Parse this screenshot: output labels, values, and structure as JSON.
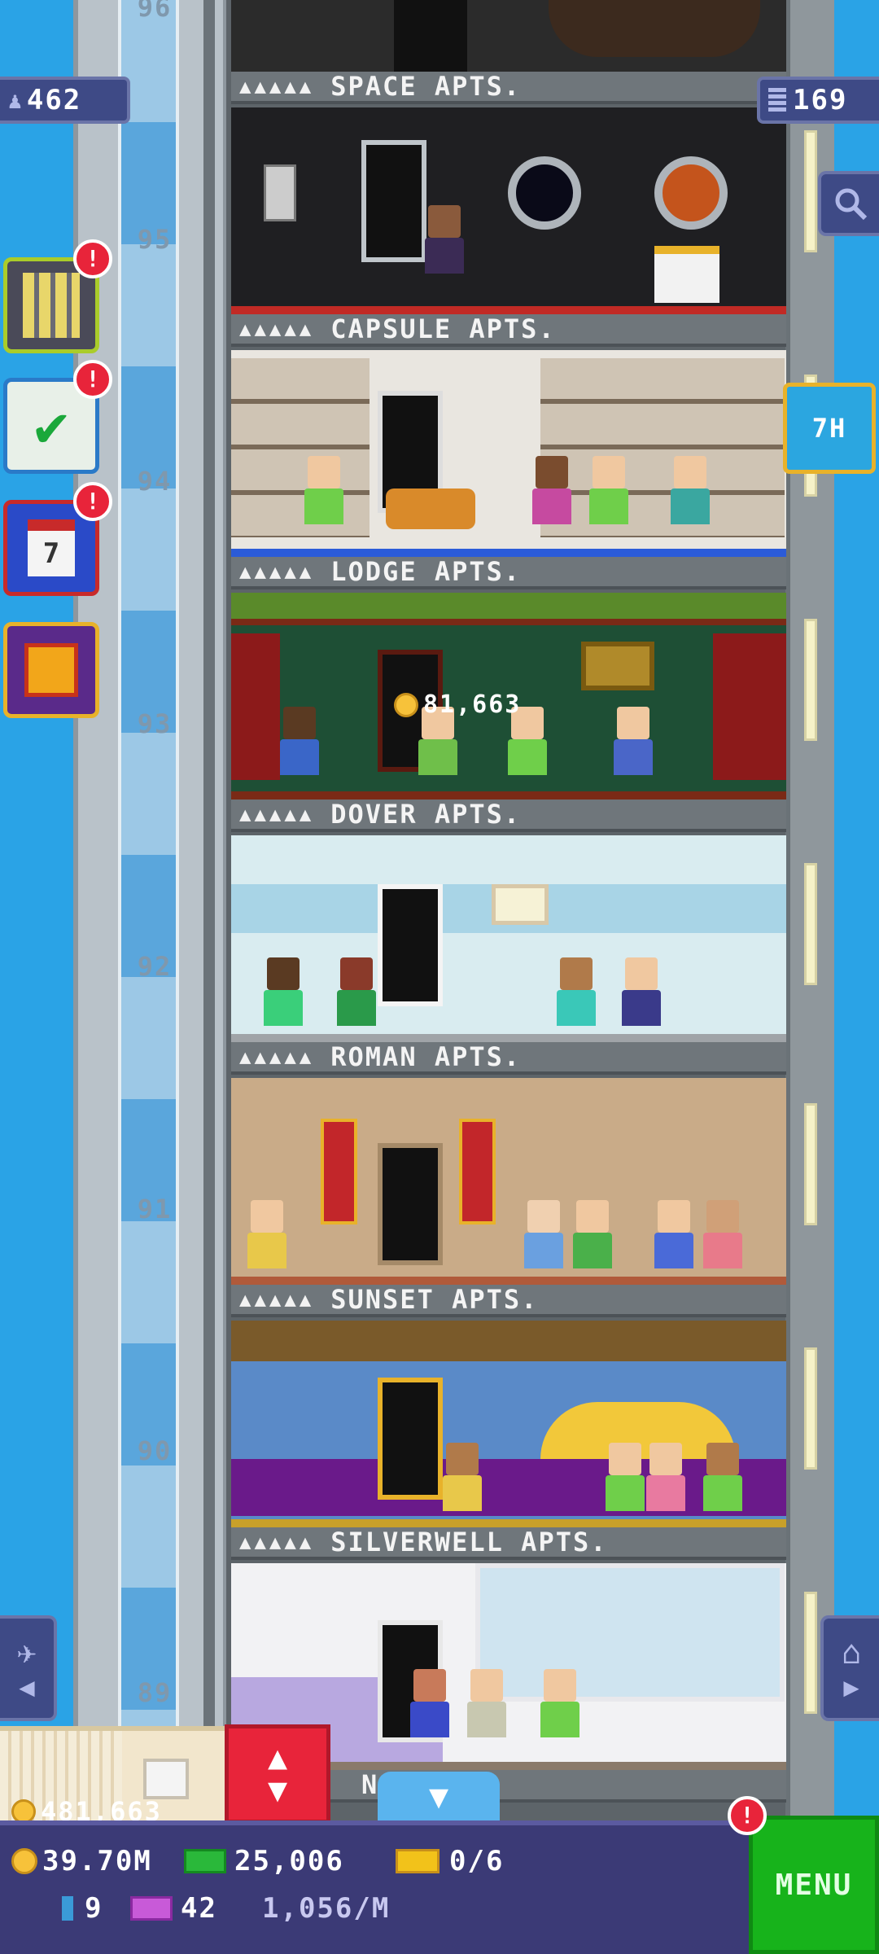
{
  "hud_top": {
    "population": "462",
    "floors": "169"
  },
  "side_timer": "7H",
  "floor_labels": [
    "96",
    "95",
    "94",
    "93",
    "92",
    "91",
    "90",
    "89"
  ],
  "floors": [
    {
      "stars": "▲▲▲▲▲",
      "name": "SPACE APTS."
    },
    {
      "stars": "▲▲▲▲▲",
      "name": "CAPSULE APTS."
    },
    {
      "stars": "▲▲▲▲▲",
      "name": "LODGE APTS."
    },
    {
      "stars": "▲▲▲▲▲",
      "name": "DOVER APTS."
    },
    {
      "stars": "▲▲▲▲▲",
      "name": "ROMAN APTS."
    },
    {
      "stars": "▲▲▲▲▲",
      "name": "SUNSET APTS."
    },
    {
      "stars": "▲▲▲▲▲",
      "name": "SILVERWELL APTS."
    },
    {
      "stars": "",
      "name": "N  TS."
    }
  ],
  "floating_coin": "81,663",
  "elevator_coins": "481,663",
  "bottom": {
    "coins": "39.70M",
    "bux": "25,006",
    "tickets": "0/6",
    "keys": "9",
    "vip": "42",
    "rate": "1,056/M",
    "menu_label": "MENU"
  },
  "alert_mark": "!",
  "icons": {
    "population": "person-icon",
    "floors": "building-icon",
    "search": "magnifier-icon",
    "calendar": "calendar-icon",
    "gift": "gift-icon",
    "checklist": "checklist-icon"
  },
  "colors": {
    "sky": "#2aa3e6",
    "hud": "#3b3a76",
    "menu": "#17b31b",
    "alert": "#e8243a"
  }
}
